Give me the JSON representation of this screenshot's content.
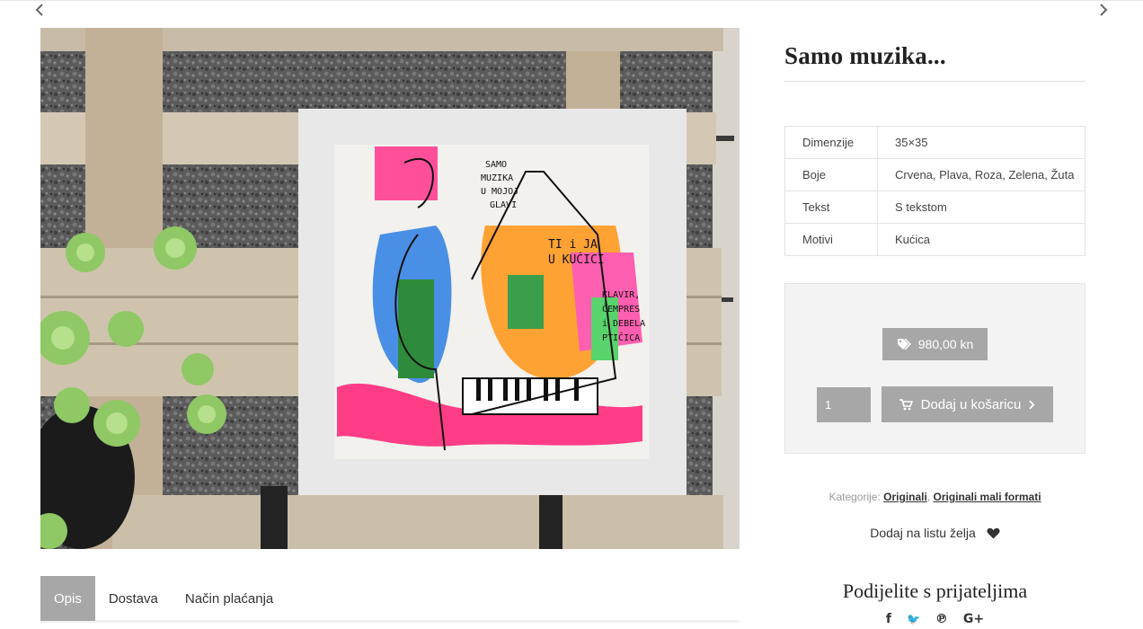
{
  "product": {
    "title": "Samo muzika...",
    "image_alt": "Samo muzika painting",
    "attributes": [
      {
        "key": "Dimenzije",
        "value": "35×35"
      },
      {
        "key": "Boje",
        "value": "Crvena, Plava, Roza, Zelena, Žuta"
      },
      {
        "key": "Tekst",
        "value": "S tekstom"
      },
      {
        "key": "Motivi",
        "value": "Kućica"
      }
    ],
    "price": "980,00 kn",
    "quantity": "1",
    "add_to_cart_label": "Dodaj u košaricu",
    "categories_label": "Kategorije:",
    "categories": [
      "Originali",
      "Originali mali formati"
    ],
    "category_separator": ",",
    "wishlist_label": "Dodaj na listu želja"
  },
  "tabs": [
    {
      "label": "Opis",
      "active": true
    },
    {
      "label": "Dostava",
      "active": false
    },
    {
      "label": "Način plaćanja",
      "active": false
    }
  ],
  "share": {
    "title": "Podijelite s prijateljima",
    "icons": [
      {
        "name": "facebook-icon",
        "glyph": "f"
      },
      {
        "name": "twitter-icon",
        "glyph": "🐦"
      },
      {
        "name": "pinterest-icon",
        "glyph": "℗"
      },
      {
        "name": "google-plus-icon",
        "glyph": "G+"
      }
    ]
  },
  "painting_text": {
    "line1": "SAMO",
    "line2": "MUZIKA",
    "line3": "U MOJOJ",
    "line4": "GLAVI",
    "line5": "TI i JA",
    "line6": "U KUĆICI",
    "line7": "KLAVIR,",
    "line8": "ČEMPRES",
    "line9": "i DEBELA",
    "line10": "PTIČICA"
  },
  "colors": {
    "accent_gray": "#a7a7a7",
    "panel_bg": "#f3f3f3"
  }
}
